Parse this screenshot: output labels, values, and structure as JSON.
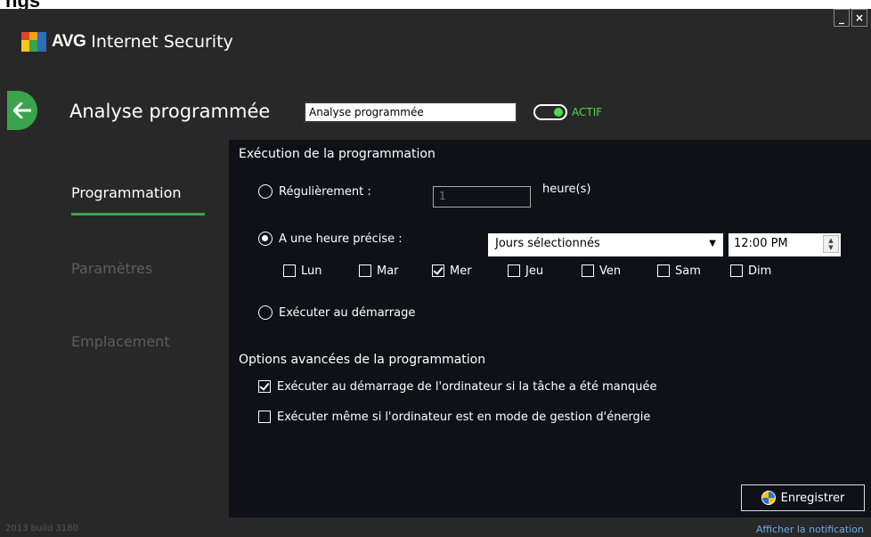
{
  "window_title_fragment": "ngs",
  "window_controls": {
    "minimize": "_",
    "close": "×"
  },
  "app": {
    "brand": "AVG",
    "product": "Internet Security"
  },
  "header": {
    "title": "Analyse programmée",
    "name_value": "Analyse programmée",
    "toggle_label": "ACTIF"
  },
  "sidebar": {
    "items": [
      "Programmation",
      "Paramètres",
      "Emplacement"
    ]
  },
  "schedule": {
    "section_title": "Exécution de la programmation",
    "regularly_label": "Régulièrement :",
    "interval_value": "1",
    "interval_unit": "heure(s)",
    "specific_label": "A une heure précise :",
    "frequency_value": "Jours sélectionnés",
    "time_value": "12:00 PM",
    "days": [
      {
        "label": "Lun",
        "checked": false
      },
      {
        "label": "Mar",
        "checked": false
      },
      {
        "label": "Mer",
        "checked": true
      },
      {
        "label": "Jeu",
        "checked": false
      },
      {
        "label": "Ven",
        "checked": false
      },
      {
        "label": "Sam",
        "checked": false
      },
      {
        "label": "Dim",
        "checked": false
      }
    ],
    "startup_label": "Exécuter au démarrage"
  },
  "advanced": {
    "section_title": "Options avancées de la programmation",
    "missed_label": "Exécuter au démarrage de l'ordinateur si la tâche a été manquée",
    "missed_checked": true,
    "power_label": "Exécuter même si l'ordinateur est en mode de gestion d'énergie",
    "power_checked": false
  },
  "buttons": {
    "save": "Enregistrer"
  },
  "footer": {
    "build": "2013  build 3180",
    "notification": "Afficher la notification"
  },
  "colors": {
    "accent_green": "#3aa34b",
    "panel_bg": "#0f1117",
    "window_bg": "#282828",
    "link_blue": "#6fa8e8"
  },
  "icons": {
    "back": "arrow-left-icon",
    "logo": "avg-logo-icon",
    "shield": "uac-shield-icon"
  }
}
